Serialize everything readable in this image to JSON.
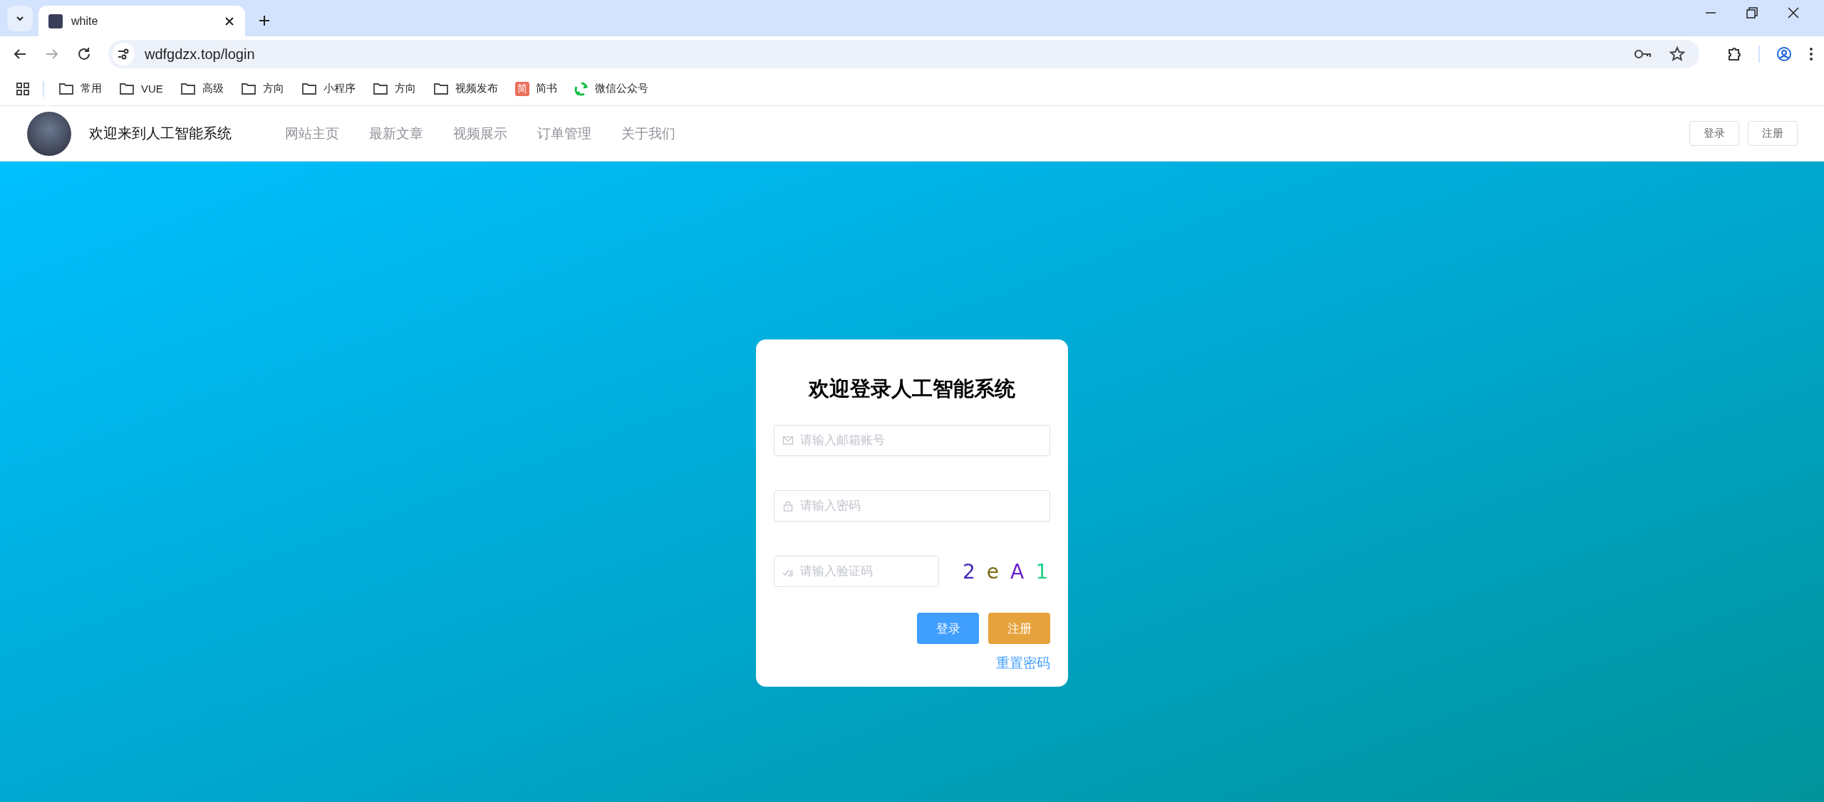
{
  "browser": {
    "tab": {
      "title": "white",
      "selected": true
    },
    "url": "wdfgdzx.top/login",
    "bookmarks": [
      {
        "kind": "folder",
        "label": "常用"
      },
      {
        "kind": "folder",
        "label": "VUE"
      },
      {
        "kind": "folder",
        "label": "高级"
      },
      {
        "kind": "folder",
        "label": "方向"
      },
      {
        "kind": "folder",
        "label": "小程序"
      },
      {
        "kind": "folder",
        "label": "方向"
      },
      {
        "kind": "folder",
        "label": "视频发布"
      },
      {
        "kind": "jianshu",
        "label": "简书",
        "glyph": "简"
      },
      {
        "kind": "wechat",
        "label": "微信公众号"
      }
    ]
  },
  "site_header": {
    "brand": "欢迎来到人工智能系统",
    "nav": [
      {
        "label": "网站主页"
      },
      {
        "label": "最新文章"
      },
      {
        "label": "视频展示"
      },
      {
        "label": "订单管理"
      },
      {
        "label": "关于我们"
      }
    ],
    "buttons": [
      {
        "label": "登录"
      },
      {
        "label": "注册"
      }
    ]
  },
  "login_card": {
    "title": "欢迎登录人工智能系统",
    "fields": [
      {
        "kind": "email",
        "placeholder": "请输入邮箱账号"
      },
      {
        "kind": "password",
        "placeholder": "请输入密码"
      },
      {
        "kind": "captcha",
        "placeholder": "请输入验证码"
      }
    ],
    "captcha": [
      {
        "char": "2",
        "color": "#3b2bb8"
      },
      {
        "char": "e",
        "color": "#7a6a10"
      },
      {
        "char": "A",
        "color": "#6a1fd0"
      },
      {
        "char": "1",
        "color": "#1fd08a"
      }
    ],
    "buttons": [
      {
        "kind": "primary",
        "label": "登录"
      },
      {
        "kind": "warning",
        "label": "注册"
      }
    ],
    "reset_link": "重置密码"
  }
}
